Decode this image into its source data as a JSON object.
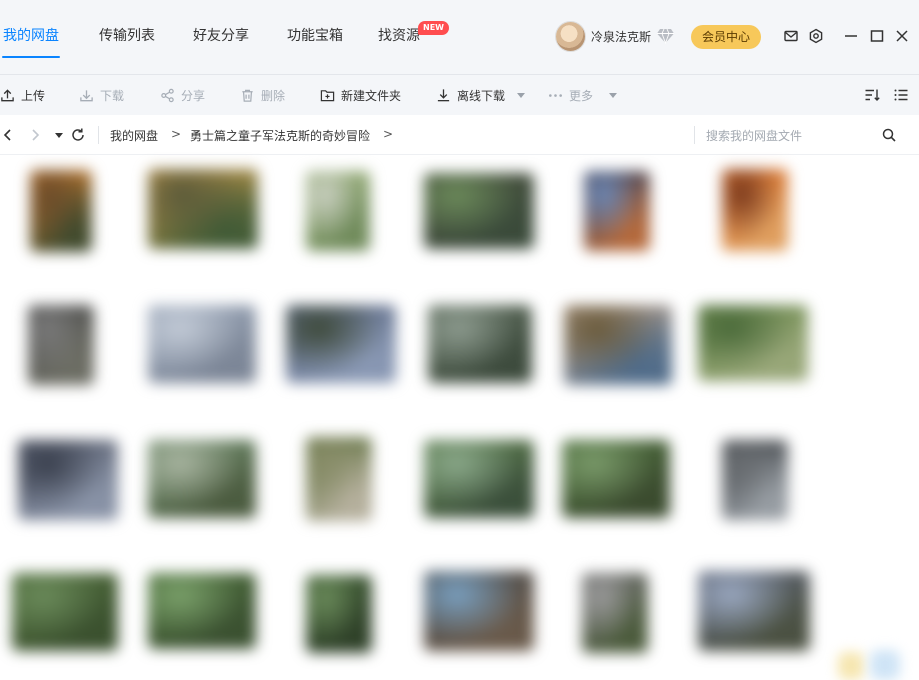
{
  "nav": {
    "tabs": [
      {
        "label": "我的网盘",
        "active": true
      },
      {
        "label": "传输列表",
        "active": false
      },
      {
        "label": "好友分享",
        "active": false
      },
      {
        "label": "功能宝箱",
        "active": false
      },
      {
        "label": "找资源",
        "active": false,
        "badge": "NEW"
      }
    ],
    "accent_color": "#0a84ff"
  },
  "user": {
    "name": "冷泉法克斯",
    "vip_icon": "diamond-icon",
    "vip_button": "会员中心"
  },
  "window_controls": [
    "mail-icon",
    "settings-icon",
    "minimize-icon",
    "maximize-icon",
    "close-icon"
  ],
  "toolbar": {
    "upload": "上传",
    "download": "下载",
    "share": "分享",
    "delete": "删除",
    "new_folder": "新建文件夹",
    "offline_download": "离线下载",
    "more": "更多"
  },
  "addressbar": {
    "breadcrumb": [
      "我的网盘",
      "勇士篇之童子军法克斯的奇妙冒险"
    ],
    "separator": ">",
    "search_placeholder": "搜索我的网盘文件"
  },
  "thumbnails": [
    {
      "colors": [
        "#c97a2e",
        "#6b4b2a",
        "#3e4a2e"
      ]
    },
    {
      "colors": [
        "#c89a4a",
        "#5b5a3a",
        "#3f5a36"
      ]
    },
    {
      "colors": [
        "#9ab07a",
        "#c9cfc1",
        "#6f8a5a"
      ]
    },
    {
      "colors": [
        "#48503e",
        "#6b8a5a",
        "#3a4a3a"
      ]
    },
    {
      "colors": [
        "#3a3d52",
        "#6d88b5",
        "#b86a3a"
      ]
    },
    {
      "colors": [
        "#d8702a",
        "#7a3a1e",
        "#e0a060"
      ]
    },
    {
      "colors": [
        "#4a4a4a",
        "#7a7a7a",
        "#6d6e64"
      ]
    },
    {
      "colors": [
        "#9aa6b8",
        "#c2cad6",
        "#7b8596"
      ]
    },
    {
      "colors": [
        "#5d6a86",
        "#3e4a3a",
        "#8a99b5"
      ]
    },
    {
      "colors": [
        "#5c6a5a",
        "#8c9a8e",
        "#3c4a3c"
      ]
    },
    {
      "colors": [
        "#b8a08a",
        "#6a5a3a",
        "#4e6b8a"
      ]
    },
    {
      "colors": [
        "#6d8a4e",
        "#4a6a3a",
        "#9aa87a"
      ]
    },
    {
      "colors": [
        "#5a6070",
        "#3a404e",
        "#8a94a8"
      ]
    },
    {
      "colors": [
        "#6d8a6a",
        "#a8b4a0",
        "#4a5a3e"
      ]
    },
    {
      "colors": [
        "#5c6e3c",
        "#8a8e6a",
        "#b8b2a0"
      ]
    },
    {
      "colors": [
        "#5a7a4a",
        "#8aa88a",
        "#3a4e3a"
      ]
    },
    {
      "colors": [
        "#4a6a3a",
        "#7a9a6a",
        "#3a4a2e"
      ]
    },
    {
      "colors": [
        "#3a3e42",
        "#6a6e72",
        "#9aa0a6"
      ]
    },
    {
      "colors": [
        "#4e6a3a",
        "#6a8a5a",
        "#3a502e"
      ]
    },
    {
      "colors": [
        "#4a6a3a",
        "#7aa06a",
        "#3a5030"
      ]
    },
    {
      "colors": [
        "#3e5a34",
        "#6a8a5a",
        "#2e4028"
      ]
    },
    {
      "colors": [
        "#4a4a4a",
        "#7aa0c0",
        "#6a5a4a"
      ]
    },
    {
      "colors": [
        "#6a6a6a",
        "#9a9a9a",
        "#4a5a3a"
      ]
    },
    {
      "colors": [
        "#5a6070",
        "#9aa8c0",
        "#4a5040"
      ]
    }
  ]
}
